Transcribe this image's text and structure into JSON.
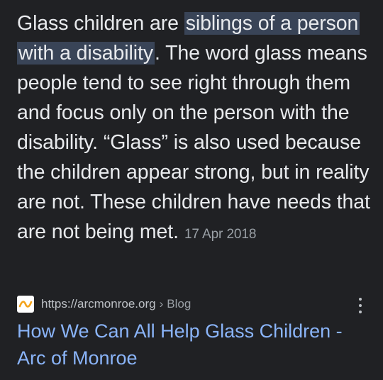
{
  "snippet": {
    "text_before": "Glass children are ",
    "highlight": "siblings of a person with a disability",
    "text_after": ". The word glass means people tend to see right through them and focus only on the person with the disability. “Glass” is also used because the children appear strong, but in reality are not. These children have needs that are not being met.",
    "date": "17 Apr 2018"
  },
  "source": {
    "url": "https://arcmonroe.org",
    "separator": "›",
    "breadcrumb": "Blog",
    "favicon_icon": "arc-monroe-logo-icon",
    "menu_icon": "more-vert-icon"
  },
  "result": {
    "title": "How We Can All Help Glass Children - Arc of Monroe"
  },
  "colors": {
    "background": "#202124",
    "text": "#e8eaed",
    "highlight_bg": "#394457",
    "link": "#8ab4f8",
    "meta": "#9aa0a6"
  }
}
